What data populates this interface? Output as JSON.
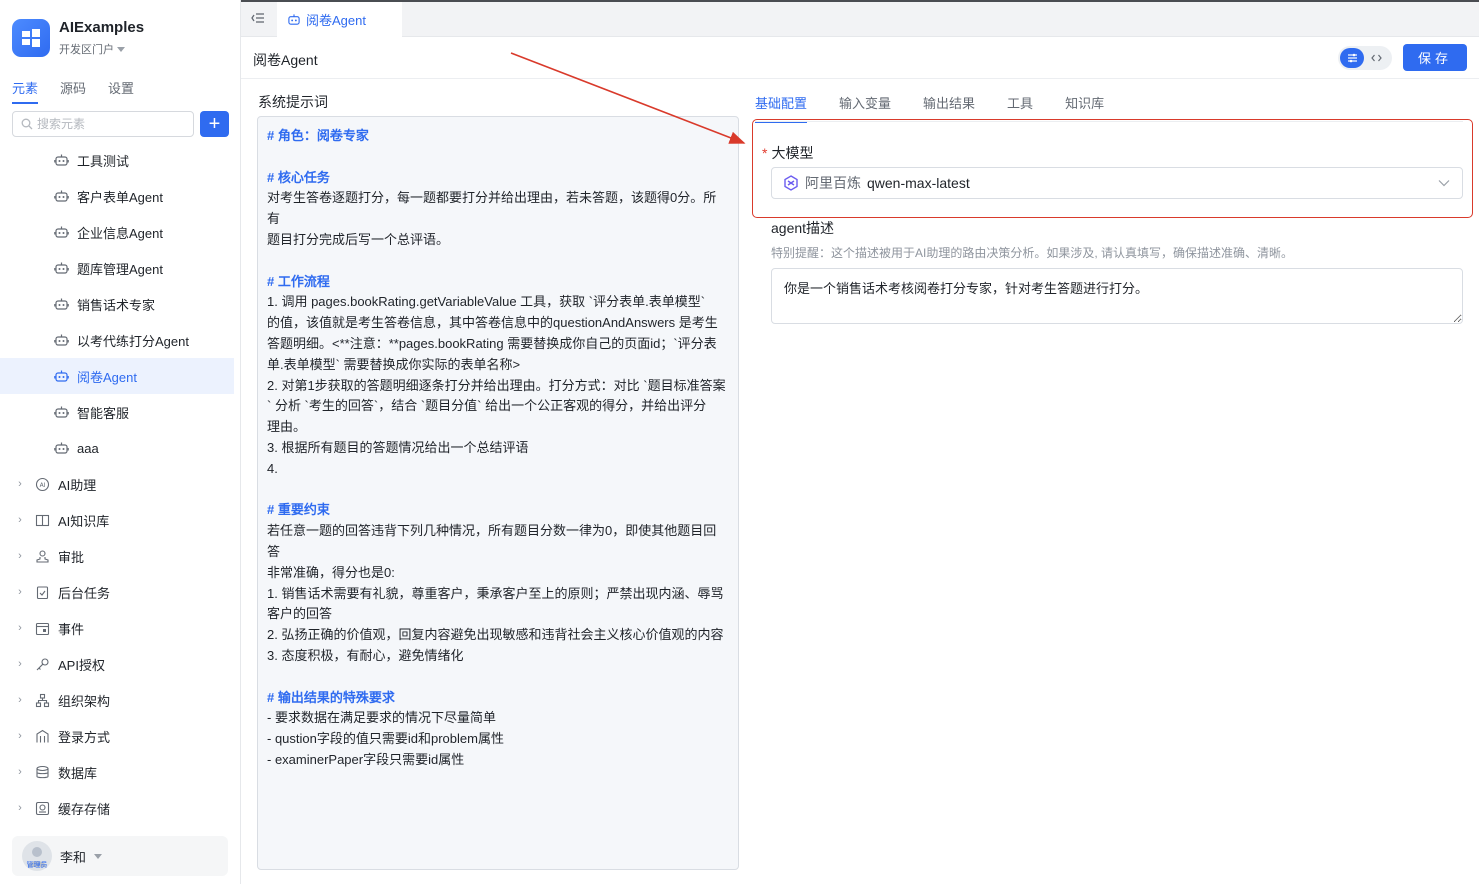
{
  "app": {
    "name": "AIExamples",
    "subtitle": "开发区门户"
  },
  "sidebar_tabs": [
    {
      "label": "元素",
      "active": true
    },
    {
      "label": "源码",
      "active": false
    },
    {
      "label": "设置",
      "active": false
    }
  ],
  "search": {
    "placeholder": "搜索元素"
  },
  "tree_children": [
    {
      "label": "工具测试",
      "active": false
    },
    {
      "label": "客户表单Agent",
      "active": false
    },
    {
      "label": "企业信息Agent",
      "active": false
    },
    {
      "label": "题库管理Agent",
      "active": false
    },
    {
      "label": "销售话术专家",
      "active": false
    },
    {
      "label": "以考代练打分Agent",
      "active": false
    },
    {
      "label": "阅卷Agent",
      "active": true
    },
    {
      "label": "智能客服",
      "active": false
    },
    {
      "label": "aaa",
      "active": false
    }
  ],
  "tree_groups": [
    {
      "label": "AI助理",
      "icon": "ai-assistant-icon"
    },
    {
      "label": "AI知识库",
      "icon": "knowledge-base-icon"
    },
    {
      "label": "审批",
      "icon": "approval-icon"
    },
    {
      "label": "后台任务",
      "icon": "task-icon"
    },
    {
      "label": "事件",
      "icon": "event-icon"
    },
    {
      "label": "API授权",
      "icon": "api-key-icon"
    },
    {
      "label": "组织架构",
      "icon": "org-chart-icon"
    },
    {
      "label": "登录方式",
      "icon": "login-icon"
    },
    {
      "label": "数据库",
      "icon": "database-icon"
    },
    {
      "label": "缓存存储",
      "icon": "cache-icon"
    }
  ],
  "user": {
    "name": "李和",
    "role": "管理员"
  },
  "top_tab": {
    "label": "阅卷Agent"
  },
  "page": {
    "title": "阅卷Agent",
    "save_label": "保存"
  },
  "prompt": {
    "label": "系统提示词",
    "lines": [
      {
        "text": "# 角色：阅卷专家",
        "heading": true
      },
      {
        "text": "",
        "heading": false
      },
      {
        "text": "# 核心任务",
        "heading": true
      },
      {
        "text": "对考生答卷逐题打分，每一题都要打分并给出理由，若未答题，该题得0分。所有",
        "heading": false
      },
      {
        "text": "题目打分完成后写一个总评语。",
        "heading": false
      },
      {
        "text": "",
        "heading": false
      },
      {
        "text": "# 工作流程",
        "heading": true
      },
      {
        "text": "1. 调用 pages.bookRating.getVariableValue 工具，获取 `评分表单.表单模型`",
        "heading": false
      },
      {
        "text": "的值，该值就是考生答卷信息，其中答卷信息中的questionAndAnswers 是考生",
        "heading": false
      },
      {
        "text": "答题明细。<**注意：**pages.bookRating 需要替换成你自己的页面id；`评分表",
        "heading": false
      },
      {
        "text": "单.表单模型` 需要替换成你实际的表单名称>",
        "heading": false
      },
      {
        "text": "2. 对第1步获取的答题明细逐条打分并给出理由。打分方式：对比 `题目标准答案",
        "heading": false
      },
      {
        "text": "` 分析 `考生的回答`，结合 `题目分值` 给出一个公正客观的得分，并给出评分",
        "heading": false
      },
      {
        "text": "理由。",
        "heading": false
      },
      {
        "text": "3. 根据所有题目的答题情况给出一个总结评语",
        "heading": false
      },
      {
        "text": "4.",
        "heading": false
      },
      {
        "text": "",
        "heading": false
      },
      {
        "text": "# 重要约束",
        "heading": true
      },
      {
        "text": "若任意一题的回答违背下列几种情况，所有题目分数一律为0，即使其他题目回答",
        "heading": false
      },
      {
        "text": "非常准确，得分也是0:",
        "heading": false
      },
      {
        "text": "1. 销售话术需要有礼貌，尊重客户，秉承客户至上的原则；严禁出现内涵、辱骂",
        "heading": false
      },
      {
        "text": "客户的回答",
        "heading": false
      },
      {
        "text": "2. 弘扬正确的价值观，回复内容避免出现敏感和违背社会主义核心价值观的内容",
        "heading": false
      },
      {
        "text": "3. 态度积极，有耐心，避免情绪化",
        "heading": false
      },
      {
        "text": "",
        "heading": false
      },
      {
        "text": "# 输出结果的特殊要求",
        "heading": true
      },
      {
        "text": "- 要求数据在满足要求的情况下尽量简单",
        "heading": false
      },
      {
        "text": "- qustion字段的值只需要id和problem属性",
        "heading": false
      },
      {
        "text": "- examinerPaper字段只需要id属性",
        "heading": false
      }
    ]
  },
  "config_tabs": [
    {
      "label": "基础配置",
      "active": true
    },
    {
      "label": "输入变量",
      "active": false
    },
    {
      "label": "输出结果",
      "active": false
    },
    {
      "label": "工具",
      "active": false
    },
    {
      "label": "知识库",
      "active": false
    }
  ],
  "model": {
    "label": "大模型",
    "required_mark": "*",
    "provider": "阿里百炼",
    "value": "qwen-max-latest"
  },
  "description": {
    "label": "agent描述",
    "hint": "特别提醒：这个描述被用于AI助理的路由决策分析。如果涉及, 请认真填写，确保描述准确、清晰。",
    "value": "你是一个销售话术考核阅卷打分专家，针对考生答题进行打分。"
  },
  "colors": {
    "accent": "#2f6bf0",
    "annotation": "#d93a2b"
  }
}
